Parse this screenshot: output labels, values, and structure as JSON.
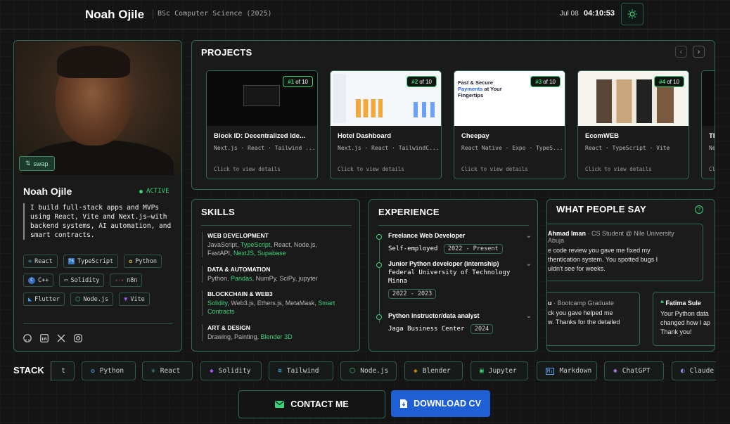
{
  "header": {
    "name": "Noah Ojile",
    "degree": "BSc Computer Science (2025)",
    "date": "Jul 08",
    "time": "04:10:53"
  },
  "profile": {
    "swap_label": "swap",
    "name": "Noah Ojile",
    "status": "ACTIVE",
    "bio": "I build full-stack apps and MVPs using React, Vite and Next.js—with backend systems, AI automation, and smart contracts.",
    "chips": [
      {
        "label": "React",
        "icon": "react-icon"
      },
      {
        "label": "TypeScript",
        "icon": "typescript-icon"
      },
      {
        "label": "Python",
        "icon": "python-icon"
      },
      {
        "label": "C++",
        "icon": "cplusplus-icon"
      },
      {
        "label": "Solidity",
        "icon": "solidity-icon"
      },
      {
        "label": "n8n",
        "icon": "n8n-icon"
      },
      {
        "label": "Flutter",
        "icon": "flutter-icon"
      },
      {
        "label": "Node.js",
        "icon": "nodejs-icon"
      },
      {
        "label": "Vite",
        "icon": "vite-icon"
      }
    ],
    "socials": [
      "github-icon",
      "linkedin-icon",
      "x-icon",
      "instagram-icon"
    ]
  },
  "projects": {
    "title": "PROJECTS",
    "cards": [
      {
        "index": "#1",
        "of": "of 10",
        "title": "Block ID: Decentralized Ide...",
        "stack": "Next.js · React · Tailwind ...",
        "cta": "Click to view details"
      },
      {
        "index": "#2",
        "of": "of 10",
        "title": "Hotel Dashboard",
        "stack": "Next.js · React · TailwindC...",
        "cta": "Click to view details"
      },
      {
        "index": "#3",
        "of": "of 10",
        "title": "Cheepay",
        "stack": "React Native · Expo · TypeS...",
        "cta": "Click to view details",
        "thumb_line1": "Fast & Secure",
        "thumb_line2": "Payments",
        "thumb_line2b": " at Your",
        "thumb_line3": "Fingertips"
      },
      {
        "index": "#4",
        "of": "of 10",
        "title": "EcomWEB",
        "stack": "React · TypeScript · Vite",
        "cta": "Click to view details"
      },
      {
        "index": "",
        "of": "",
        "title": "Tl",
        "stack": "Ne",
        "cta": "Cl"
      }
    ]
  },
  "skills": {
    "title": "SKILLS",
    "groups": [
      {
        "heading": "WEB DEVELOPMENT",
        "l1a": "JavaScript, ",
        "l1b": "TypeScript",
        "l1c": ", React, Node.js,",
        "l2a": "FastAPI, ",
        "l2b": "NextJS",
        "l2c": ", ",
        "l2d": "Supabase"
      },
      {
        "heading": "DATA & AUTOMATION",
        "l1a": "Python, ",
        "l1b": "Pandas",
        "l1c": ", NumPy, SciPy, jupyter"
      },
      {
        "heading": "BLOCKCHAIN & WEB3",
        "l1a": "Solidity",
        "l1b": ", Web3.js, Ethers.js, MetaMask, ",
        "l1c": "Smart",
        "l2a": "Contracts"
      },
      {
        "heading": "ART & DESIGN",
        "l1a": "Drawing, Painting, ",
        "l1b": "Blender 3D"
      }
    ]
  },
  "experience": {
    "title": "EXPERIENCE",
    "items": [
      {
        "role": "Freelance Web Developer",
        "org": "Self-employed",
        "date": "2022 - Present"
      },
      {
        "role": "Junior Python developer (internship)",
        "org": "Federal University of Technology Minna",
        "date": "2022 - 2023"
      },
      {
        "role": "Python instructor/data analyst",
        "org": "Jaga Business Center",
        "date": "2024"
      }
    ]
  },
  "testimonials": {
    "title": "WHAT PEOPLE SAY",
    "cards": [
      {
        "name": "Ahmad Iman",
        "role": "· CS Student @ Nile University",
        "role2": "Abuja",
        "l1": "e code review you gave me fixed my",
        "l2": "thentication system. You spotted bugs I",
        "l3": "uldn't see for weeks."
      },
      {
        "name": "u",
        "role": "· Bootcamp Graduate",
        "l1": "ck you gave helped me",
        "l2": "w. Thanks for the detailed"
      },
      {
        "name": "Fatima Sule",
        "quote": "❝",
        "l1": "Your Python data",
        "l2": "changed how I ap",
        "l3": "Thank you!"
      }
    ]
  },
  "stack": {
    "label": "STACK",
    "items": [
      {
        "label": "t",
        "icon": "script-icon"
      },
      {
        "label": "Python",
        "icon": "python-icon"
      },
      {
        "label": "React",
        "icon": "react-icon"
      },
      {
        "label": "Solidity",
        "icon": "solidity-icon"
      },
      {
        "label": "Tailwind",
        "icon": "tailwind-icon"
      },
      {
        "label": "Node.js",
        "icon": "nodejs-icon"
      },
      {
        "label": "Blender",
        "icon": "blender-icon"
      },
      {
        "label": "Jupyter",
        "icon": "jupyter-icon"
      },
      {
        "label": "Markdown",
        "icon": "markdown-icon"
      },
      {
        "label": "ChatGPT",
        "icon": "chatgpt-icon"
      },
      {
        "label": "Claude",
        "icon": "claude-icon"
      }
    ]
  },
  "actions": {
    "contact": "CONTACT ME",
    "cv": "DOWNLOAD CV"
  },
  "colors": {
    "accent": "#3bd37a",
    "border": "#2e6b52",
    "background": "#141414",
    "cv_button": "#1f5fd6"
  }
}
